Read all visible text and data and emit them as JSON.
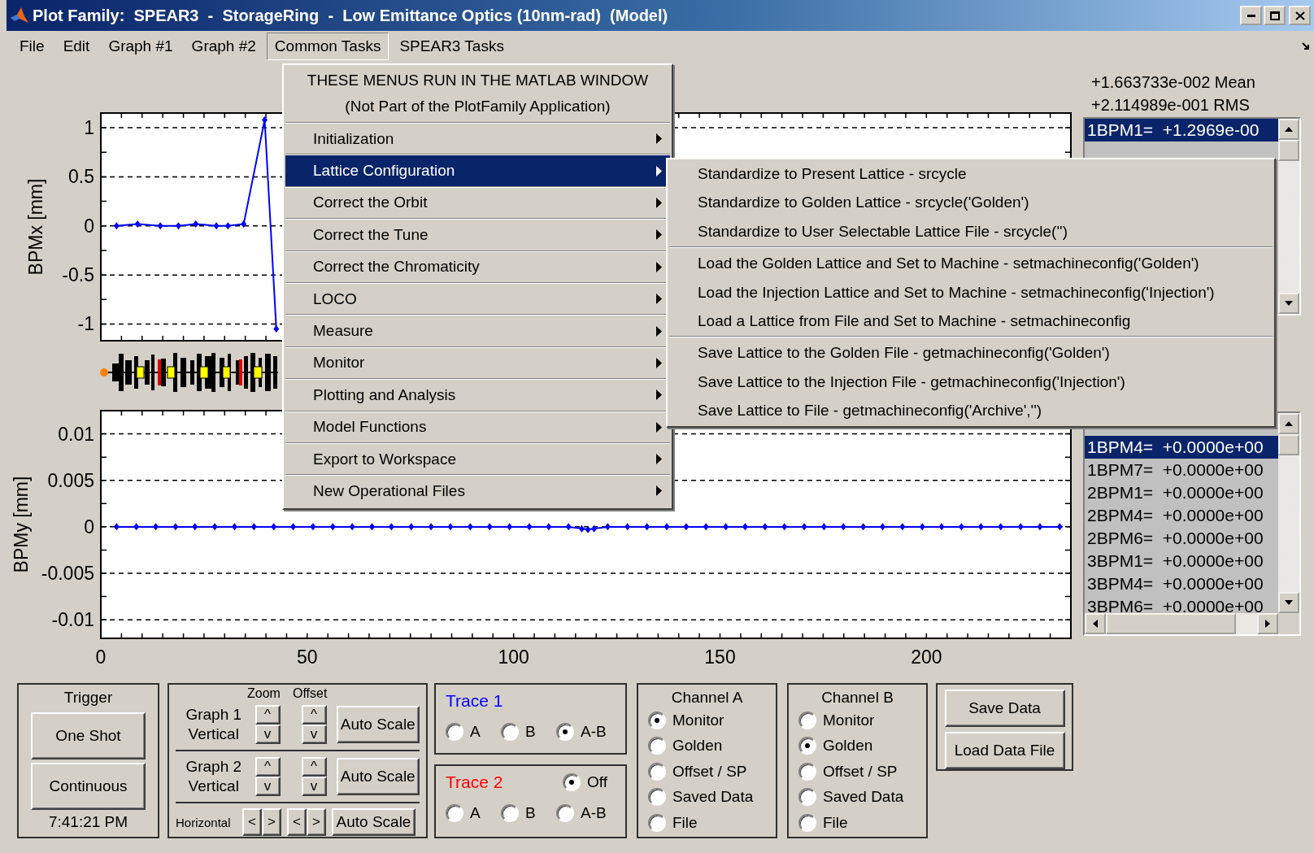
{
  "window": {
    "title": "Plot Family:  SPEAR3  -  StorageRing  -  Low Emittance Optics (10nm-rad)  (Model)"
  },
  "menu_bar": [
    {
      "label": "File",
      "selected": false
    },
    {
      "label": "Edit",
      "selected": false
    },
    {
      "label": "Graph #1",
      "selected": false
    },
    {
      "label": "Graph #2",
      "selected": false
    },
    {
      "label": "Common Tasks",
      "selected": true
    },
    {
      "label": "SPEAR3 Tasks",
      "selected": false
    }
  ],
  "dropdown": {
    "notice": [
      "THESE MENUS RUN IN THE MATLAB WINDOW",
      "(Not Part of the PlotFamily Application)"
    ],
    "items": [
      {
        "label": "Initialization",
        "selected": false
      },
      {
        "label": "Lattice Configuration",
        "selected": true
      },
      {
        "label": "Correct the Orbit",
        "selected": false
      },
      {
        "label": "Correct the Tune",
        "selected": false
      },
      {
        "label": "Correct the Chromaticity",
        "selected": false
      },
      {
        "label": "LOCO",
        "selected": false
      },
      {
        "label": "Measure",
        "selected": false
      },
      {
        "label": "Monitor",
        "selected": false
      },
      {
        "label": "Plotting and Analysis",
        "selected": false
      },
      {
        "label": "Model Functions",
        "selected": false
      },
      {
        "label": "Export to Workspace",
        "selected": false
      },
      {
        "label": "New Operational Files",
        "selected": false
      }
    ]
  },
  "submenu": {
    "groups": [
      {
        "items": [
          "Standardize to Present Lattice - srcycle",
          "Standardize to Golden Lattice - srcycle('Golden')",
          "Standardize to User Selectable Lattice File - srcycle('')"
        ]
      },
      {
        "items": [
          "Load the Golden Lattice and Set to Machine - setmachineconfig('Golden')",
          "Load the Injection Lattice and Set to Machine - setmachineconfig('Injection')",
          "Load a Lattice from File and Set to Machine - setmachineconfig"
        ]
      },
      {
        "items": [
          "Save Lattice to the Golden File - getmachineconfig('Golden')",
          "Save Lattice to the Injection File - getmachineconfig('Injection')",
          "Save Lattice to File - getmachineconfig('Archive','')"
        ]
      }
    ]
  },
  "graph_1": {
    "chart_data": {
      "type": "line",
      "ylabel": "BPMx [mm]",
      "x": [
        3.8,
        8.9,
        14.4,
        18.8,
        23,
        28,
        30.8,
        34.6,
        39.7,
        42.5
      ],
      "grid": true,
      "series": [
        {
          "color": "#0000ff",
          "marker": "diamond",
          "values": [
            0,
            0.02,
            0,
            0,
            0.02,
            0,
            0,
            0.02,
            1.08,
            -1.05
          ]
        }
      ],
      "xlim": [
        0,
        235
      ],
      "ylim": [
        -1.17,
        1.15
      ],
      "yticks": [
        -1,
        -0.5,
        0,
        0.5,
        1
      ]
    }
  },
  "graph_2": {
    "chart_data": {
      "type": "line",
      "ylabel": "BPMy [mm]",
      "x": [
        3.8,
        8.6,
        13.3,
        18.1,
        22.8,
        27.6,
        32.4,
        37.1,
        41.9,
        46.6,
        51.4,
        56.2,
        60.9,
        65.7,
        70.4,
        75.2,
        80.0,
        84.7,
        89.5,
        94.2,
        99.0,
        103.8,
        108.5,
        113.3,
        116.5,
        118.0,
        119.5,
        122.8,
        127.6,
        132.3,
        137.1,
        141.8,
        146.6,
        151.4,
        156.1,
        160.9,
        165.6,
        170.4,
        175.2,
        179.9,
        184.7,
        189.4,
        194.2,
        199.0,
        203.7,
        208.5,
        213.2,
        218.0,
        222.8,
        227.5,
        232.3
      ],
      "grid": true,
      "series": [
        {
          "color": "#0000ff",
          "marker": "diamond",
          "values": [
            0,
            0,
            0,
            0,
            0,
            0,
            0,
            0,
            0,
            0,
            0,
            0,
            0,
            0,
            0,
            0,
            0,
            0,
            0,
            0,
            0,
            0,
            0,
            0,
            -0.0002,
            -0.0003,
            -0.0002,
            0,
            0,
            0,
            0,
            0,
            0,
            0,
            0,
            0,
            0,
            0,
            0,
            0,
            0,
            0,
            0,
            0,
            0,
            0,
            0,
            0,
            0,
            0,
            0
          ]
        }
      ],
      "xlim": [
        0,
        235
      ],
      "ylim": [
        -0.012,
        0.0125
      ],
      "xticks": [
        0,
        50,
        100,
        150,
        200
      ],
      "yticks": [
        -0.01,
        -0.005,
        0,
        0.005,
        0.01
      ]
    }
  },
  "stats": [
    "+1.663733e-002 Mean",
    "+2.114989e-001 RMS"
  ],
  "list_1": {
    "rows": [
      {
        "label": "1BPM1=  +1.2969e-00",
        "selected": true
      }
    ]
  },
  "list_2": {
    "rows": [
      {
        "label": "1BPM4=  +0.0000e+00",
        "selected": true
      },
      {
        "label": "1BPM7=  +0.0000e+00",
        "selected": false
      },
      {
        "label": "2BPM1=  +0.0000e+00",
        "selected": false
      },
      {
        "label": "2BPM4=  +0.0000e+00",
        "selected": false
      },
      {
        "label": "2BPM6=  +0.0000e+00",
        "selected": false
      },
      {
        "label": "3BPM1=  +0.0000e+00",
        "selected": false
      },
      {
        "label": "3BPM4=  +0.0000e+00",
        "selected": false
      },
      {
        "label": "3BPM6=  +0.0000e+00",
        "selected": false
      }
    ]
  },
  "trigger": {
    "title": "Trigger",
    "buttons": [
      "One Shot",
      "Continuous"
    ],
    "time": "7:41:21 PM"
  },
  "scale_panel": {
    "column_headers": [
      "Zoom",
      "Offset"
    ],
    "rows": [
      {
        "kind": "vertical",
        "label": [
          "Graph 1",
          "Vertical"
        ],
        "zoom": [
          "^",
          "v"
        ],
        "offset": [
          "^",
          "v"
        ],
        "button": "Auto Scale"
      },
      {
        "kind": "vertical",
        "label": [
          "Graph 2",
          "Vertical"
        ],
        "zoom": [
          "^",
          "v"
        ],
        "offset": [
          "^",
          "v"
        ],
        "button": "Auto Scale"
      },
      {
        "kind": "horizontal",
        "label": [
          "Horizontal"
        ],
        "zoom": [
          "<",
          ">"
        ],
        "offset": [
          "<",
          ">"
        ],
        "button": "Auto Scale"
      }
    ]
  },
  "traces": [
    {
      "title": "Trace 1",
      "color": "#0000ff",
      "options": [
        {
          "label": "A",
          "selected": false
        },
        {
          "label": "B",
          "selected": false
        },
        {
          "label": "A-B",
          "selected": true
        }
      ]
    },
    {
      "title": "Trace 2",
      "color": "#ff0000",
      "off": {
        "label": "Off",
        "selected": true
      },
      "options": [
        {
          "label": "A",
          "selected": false
        },
        {
          "label": "B",
          "selected": false
        },
        {
          "label": "A-B",
          "selected": false
        }
      ]
    }
  ],
  "channels": [
    {
      "title": "Channel A",
      "options": [
        {
          "label": "Monitor",
          "selected": true
        },
        {
          "label": "Golden",
          "selected": false
        },
        {
          "label": "Offset / SP",
          "selected": false
        },
        {
          "label": "Saved Data",
          "selected": false
        },
        {
          "label": "File",
          "selected": false
        }
      ]
    },
    {
      "title": "Channel B",
      "options": [
        {
          "label": "Monitor",
          "selected": false
        },
        {
          "label": "Golden",
          "selected": true
        },
        {
          "label": "Offset / SP",
          "selected": false
        },
        {
          "label": "Saved Data",
          "selected": false
        },
        {
          "label": "File",
          "selected": false
        }
      ]
    }
  ],
  "file_buttons": [
    "Save Data",
    "Load Data File"
  ]
}
